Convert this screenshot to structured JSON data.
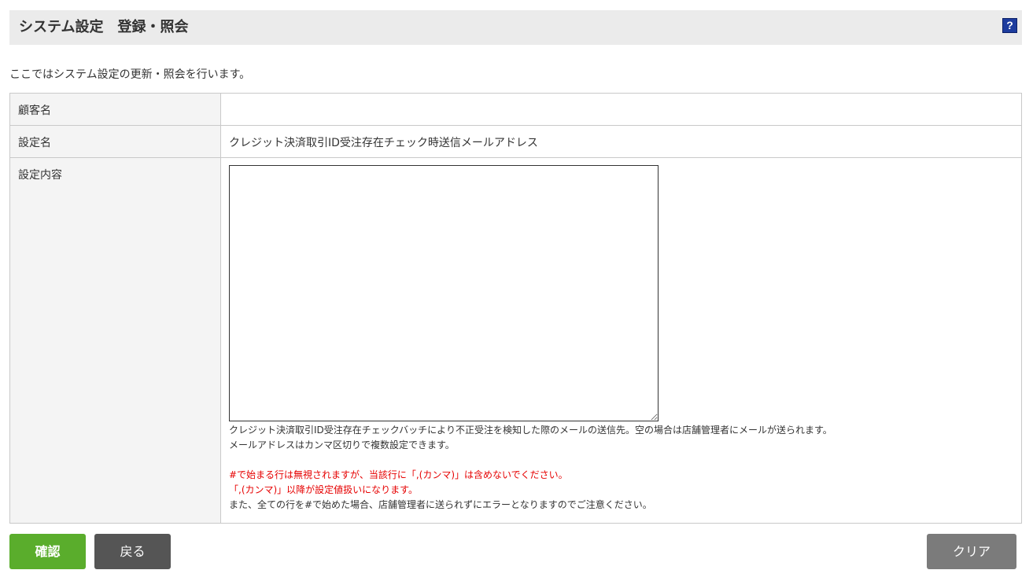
{
  "header": {
    "title": "システム設定　登録・照会",
    "help_icon": "?"
  },
  "intro": "ここではシステム設定の更新・照会を行います。",
  "form": {
    "customer_label": "顧客名",
    "customer_value": "",
    "setting_name_label": "設定名",
    "setting_name_value": "クレジット決済取引ID受注存在チェック時送信メールアドレス",
    "setting_content_label": "設定内容",
    "setting_content_value": "",
    "help_lines": {
      "line1": "クレジット決済取引ID受注存在チェックバッチにより不正受注を検知した際のメールの送信先。空の場合は店舗管理者にメールが送られます。",
      "line2": "メールアドレスはカンマ区切りで複数設定できます。",
      "warn1": "#で始まる行は無視されますが、当該行に「,(カンマ)」は含めないでください。",
      "warn2": "「,(カンマ)」以降が設定値扱いになります。",
      "line3": "また、全ての行を#で始めた場合、店舗管理者に送られずにエラーとなりますのでご注意ください。"
    }
  },
  "buttons": {
    "confirm": "確認",
    "back": "戻る",
    "clear": "クリア"
  },
  "colors": {
    "confirm": "#5aad2c",
    "back": "#555555",
    "clear": "#7b7b7b",
    "warning_text": "#e60000",
    "help_icon": "#1d3c9e"
  }
}
